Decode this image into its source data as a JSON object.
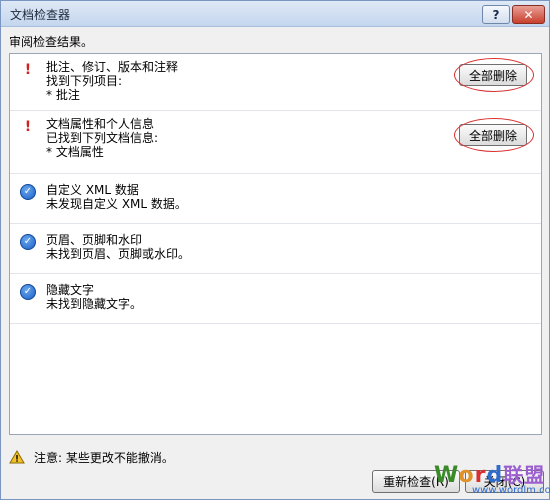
{
  "window": {
    "title": "文档检查器",
    "help_label": "?",
    "close_label": "✕"
  },
  "subtitle": "审阅检查结果。",
  "items": [
    {
      "status": "warning",
      "title": "批注、修订、版本和注释",
      "lines": [
        "找到下列项目:",
        "* 批注"
      ],
      "button": "全部删除"
    },
    {
      "status": "warning",
      "title": "文档属性和个人信息",
      "lines": [
        "已找到下列文档信息:",
        "* 文档属性"
      ],
      "button": "全部删除"
    },
    {
      "status": "ok",
      "title": "自定义 XML 数据",
      "lines": [
        "未发现自定义 XML 数据。"
      ]
    },
    {
      "status": "ok",
      "title": "页眉、页脚和水印",
      "lines": [
        "未找到页眉、页脚或水印。"
      ]
    },
    {
      "status": "ok",
      "title": "隐藏文字",
      "lines": [
        "未找到隐藏文字。"
      ]
    }
  ],
  "notice": "注意: 某些更改不能撤消。",
  "buttons": {
    "recheck": "重新检查(R)",
    "close": "关闭(C)"
  },
  "watermark": {
    "w": "W",
    "o": "o",
    "r": "r",
    "d": "d",
    "cn": "联盟",
    "url": "www.wordlm.com"
  },
  "icons": {
    "warning": "exclamation-icon",
    "ok": "check-icon",
    "notice": "warning-triangle-icon"
  }
}
